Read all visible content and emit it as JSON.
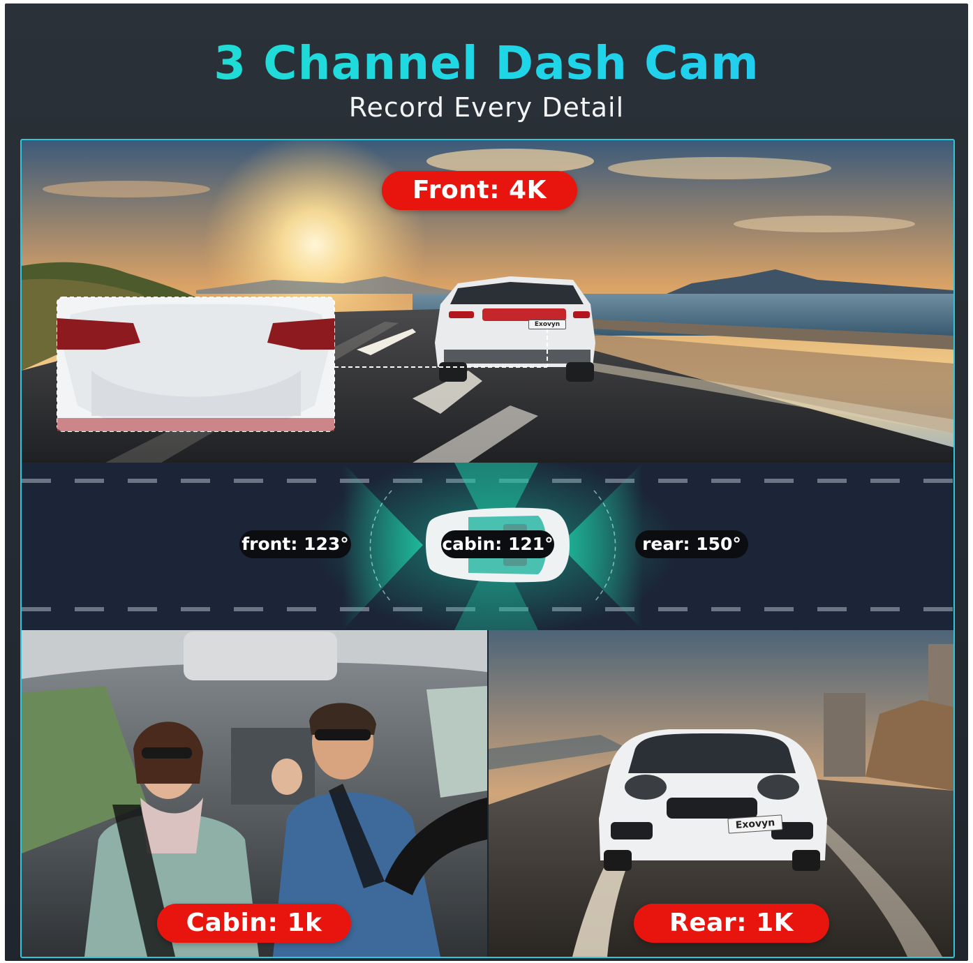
{
  "header": {
    "title": "3 Channel Dash Cam",
    "subtitle": "Record Every Detail"
  },
  "front": {
    "label": "Front: 4K",
    "plate": "Exovyn"
  },
  "angles": {
    "front": "front: 123°",
    "cabin": "cabin: 121°",
    "rear": "rear: 150°"
  },
  "cabin": {
    "label": "Cabin: 1k"
  },
  "rear": {
    "label": "Rear: 1K",
    "plate": "Exovyn"
  },
  "colors": {
    "accent": "#22e0c8",
    "badge_red": "#e8150f",
    "frame_border": "#2fc7d9",
    "dark_bg": "#1f262d"
  }
}
